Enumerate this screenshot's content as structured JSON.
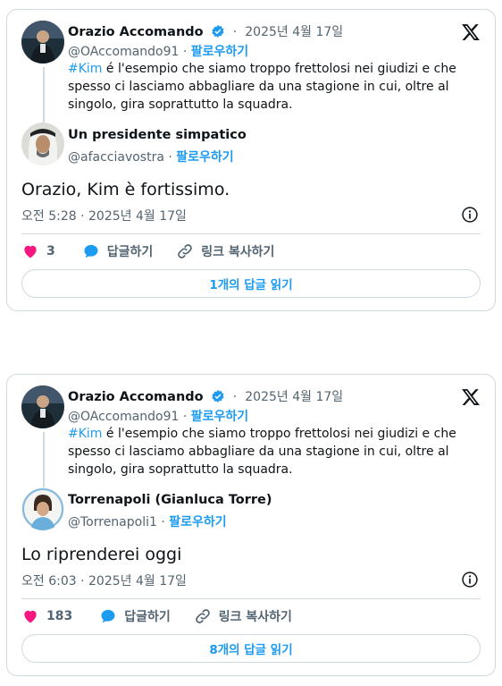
{
  "tweets": [
    {
      "parent": {
        "author_name": "Orazio Accomando",
        "dot": "·",
        "date": "2025년 4월 17일",
        "handle": "@OAccomando91",
        "follow_sep": "·",
        "follow_label": "팔로우하기",
        "hashtag": "#Kim",
        "text_rest": " é l'esempio che siamo troppo frettolosi nei giudizi e che spesso ci lasciamo abbagliare da una stagione in cui, oltre al singolo, gira soprattutto la squadra."
      },
      "reply": {
        "author_name": "Un presidente simpatico",
        "handle": "@afacciavostra",
        "follow_sep": "·",
        "follow_label": "팔로우하기",
        "text": "Orazio, Kim è fortissimo.",
        "timestamp": "오전 5:28 · 2025년 4월 17일"
      },
      "actions": {
        "likes": "3",
        "reply_label": "답글하기",
        "copy_link_label": "링크 복사하기"
      },
      "read_replies_label": "1개의 답글 읽기"
    },
    {
      "parent": {
        "author_name": "Orazio Accomando",
        "dot": "·",
        "date": "2025년 4월 17일",
        "handle": "@OAccomando91",
        "follow_sep": "·",
        "follow_label": "팔로우하기",
        "hashtag": "#Kim",
        "text_rest": " é l'esempio che siamo troppo frettolosi nei giudizi e che spesso ci lasciamo abbagliare da una stagione in cui, oltre al singolo, gira soprattutto la squadra."
      },
      "reply": {
        "author_name": "Torrenapoli (Gianluca Torre)",
        "handle": "@Torrenapoli1",
        "follow_sep": "·",
        "follow_label": "팔로우하기",
        "text": "Lo riprenderei oggi",
        "timestamp": "오전 6:03 · 2025년 4월 17일"
      },
      "actions": {
        "likes": "183",
        "reply_label": "답글하기",
        "copy_link_label": "링크 복사하기"
      },
      "read_replies_label": "8개의 답글 읽기"
    }
  ],
  "icons": {
    "brand": "x-logo-icon",
    "verified": "verified-badge-icon",
    "info": "info-icon",
    "like": "heart-icon",
    "reply": "reply-bubble-icon",
    "link": "link-icon"
  },
  "colors": {
    "accent": "#1d9bf0",
    "like": "#f91880",
    "border": "#cfd9de",
    "muted": "#536471",
    "text": "#0f1419"
  }
}
